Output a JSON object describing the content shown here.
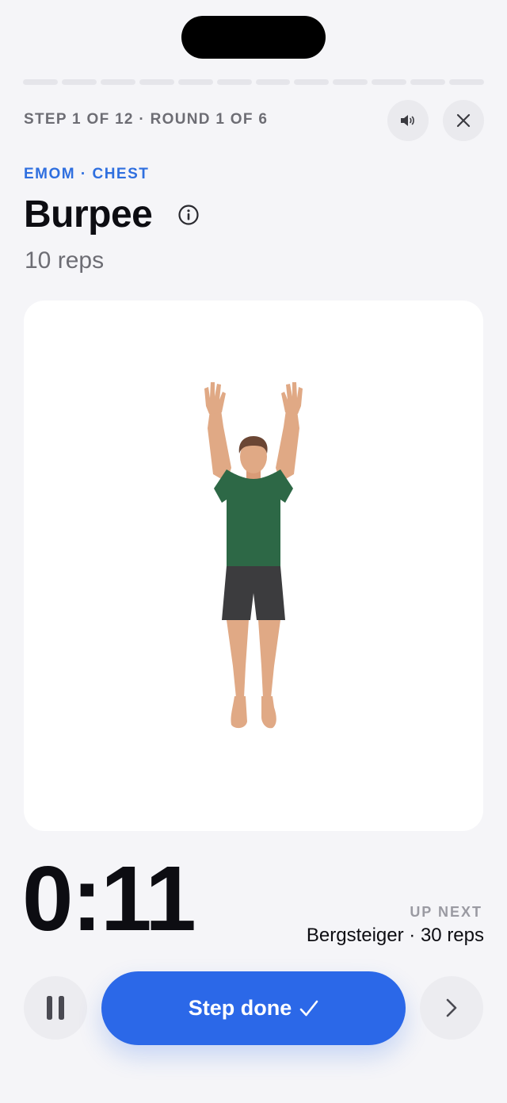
{
  "header": {
    "step_label": "STEP 1 OF 12 · ROUND 1 OF 6",
    "progress_total_steps": 12,
    "progress_completed": 0
  },
  "exercise": {
    "category": "EMOM · CHEST",
    "name": "Burpee",
    "reps": "10 reps"
  },
  "timer": {
    "value": "0:11"
  },
  "up_next": {
    "label": "UP NEXT",
    "value": "Bergsteiger · 30 reps"
  },
  "controls": {
    "step_done_label": "Step done",
    "step_done_icon": "checkmark-icon",
    "pause_icon": "pause-icon",
    "next_icon": "chevron-right-icon",
    "sound_icon": "speaker-icon",
    "close_icon": "close-icon",
    "info_icon": "info-icon"
  },
  "colors": {
    "accent": "#2b68e8",
    "category": "#2f6fdf",
    "background": "#f5f5f8"
  }
}
